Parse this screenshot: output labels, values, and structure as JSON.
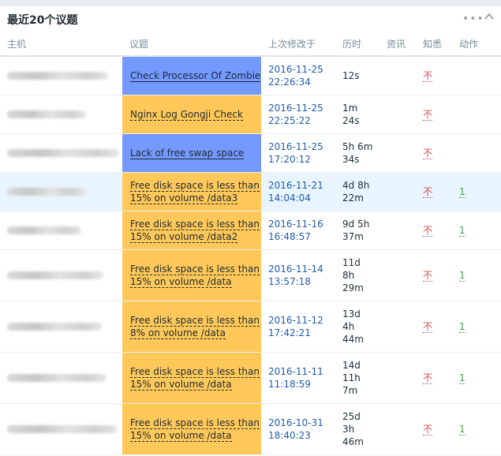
{
  "widget": {
    "title": "最近20个议题",
    "menu_icon": "more-icon",
    "collapse_icon": "chevron-up-icon"
  },
  "columns": {
    "host": "主机",
    "issue": "议题",
    "last_change": "上次修改于",
    "age": "历时",
    "info": "资讯",
    "ack": "知悉",
    "actions": "动作"
  },
  "colors": {
    "average": "#ffc859",
    "information": "#7499ff",
    "highlight_row": "#e8f5ff",
    "ack_no": "#d64e4e",
    "action_count": "#429e47"
  },
  "rows": [
    {
      "issue": "Check Processor Of Zombie",
      "severity": "information",
      "time": "2016-11-25\n22:26:34",
      "age": "12s",
      "ack": "不",
      "actions": ""
    },
    {
      "issue": "Nginx Log Gongji Check",
      "severity": "average",
      "time": "2016-11-25\n22:25:22",
      "age": "1m\n24s",
      "ack": "不",
      "actions": ""
    },
    {
      "issue": "Lack of free swap space",
      "severity": "information",
      "time": "2016-11-25\n17:20:12",
      "age": "5h 6m\n34s",
      "ack": "不",
      "actions": ""
    },
    {
      "issue": "Free disk space is less than\n15% on volume /data3",
      "severity": "average",
      "time": "2016-11-21\n14:04:04",
      "age": "4d 8h\n22m",
      "ack": "不",
      "actions": "1"
    },
    {
      "issue": "Free disk space is less than\n15% on volume /data2",
      "severity": "average",
      "time": "2016-11-16\n16:48:57",
      "age": "9d 5h\n37m",
      "ack": "不",
      "actions": "1"
    },
    {
      "issue": "Free disk space is less than\n15% on volume /data",
      "severity": "average",
      "time": "2016-11-14\n13:57:18",
      "age": "11d\n8h\n29m",
      "ack": "不",
      "actions": "1"
    },
    {
      "issue": "Free disk space is less than\n8% on volume /data",
      "severity": "average",
      "time": "2016-11-12\n17:42:21",
      "age": "13d\n4h\n44m",
      "ack": "不",
      "actions": "1"
    },
    {
      "issue": "Free disk space is less than\n15% on volume /data",
      "severity": "average",
      "time": "2016-11-11\n11:18:59",
      "age": "14d\n11h\n7m",
      "ack": "不",
      "actions": "1"
    },
    {
      "issue": "Free disk space is less than\n15% on volume /data",
      "severity": "average",
      "time": "2016-10-31\n18:40:23",
      "age": "25d\n3h\n46m",
      "ack": "不",
      "actions": "1"
    }
  ]
}
